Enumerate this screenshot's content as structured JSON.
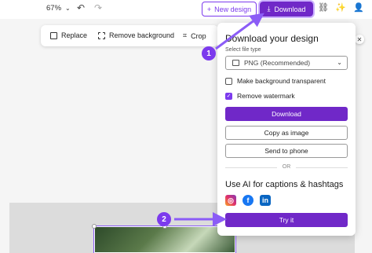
{
  "topbar": {
    "zoom": "67%",
    "new_design_label": "New design",
    "download_label": "Download"
  },
  "edit_toolbar": {
    "replace": "Replace",
    "remove_background": "Remove background",
    "crop": "Crop"
  },
  "download_panel": {
    "title": "Download your design",
    "file_type_label": "Select file type",
    "file_type_value": "PNG (Recommended)",
    "options": [
      {
        "label": "Make background transparent",
        "checked": false
      },
      {
        "label": "Remove watermark",
        "checked": true
      }
    ],
    "download_button": "Download",
    "copy_button": "Copy as image",
    "send_button": "Send to phone",
    "divider": "OR",
    "ai_title": "Use AI for captions & hashtags",
    "social_icons": [
      "instagram-icon",
      "facebook-icon",
      "linkedin-icon"
    ],
    "try_button": "Try it"
  },
  "annotations": {
    "step1": "1",
    "step2": "2"
  },
  "colors": {
    "accent": "#7028c8",
    "arrow": "#8b5cf6"
  }
}
